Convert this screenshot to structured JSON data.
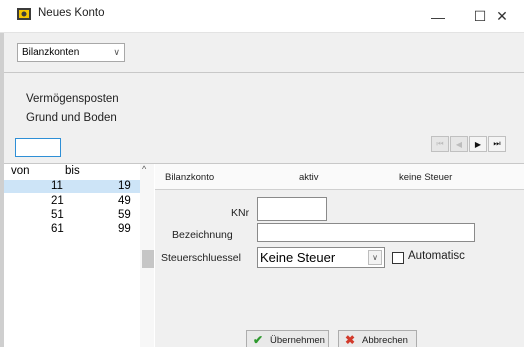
{
  "window": {
    "title": "Neues Konto",
    "minimize": "—",
    "maximize": "☐",
    "close": "✕"
  },
  "toolbar": {
    "account_type_selected": "Bilanzkonten",
    "dropdown_arrow": "∨"
  },
  "info": {
    "category": "Vermögensposten",
    "subcategory": "Grund und Boden"
  },
  "navigation": {
    "first": "⏮",
    "prev": "◀",
    "next": "▶",
    "last": "⏭"
  },
  "range_list": {
    "header_von": "von",
    "header_bis": "bis",
    "scroll_up": "^",
    "rows": [
      {
        "von": "11",
        "bis": "19"
      },
      {
        "von": "21",
        "bis": "49"
      },
      {
        "von": "51",
        "bis": "59"
      },
      {
        "von": "61",
        "bis": "99"
      }
    ]
  },
  "detail_header": {
    "account_type": "Bilanzkonto",
    "status": "aktiv",
    "tax": "keine Steuer"
  },
  "form": {
    "knr_label": "KNr",
    "knr_value": "",
    "bezeichnung_label": "Bezeichnung",
    "bezeichnung_value": "",
    "steuerschluessel_label": "Steuerschluessel",
    "steuerschluessel_value": "Keine Steuer",
    "combo_arrow": "∨",
    "automatic_label": "Automatisc",
    "automatic_checked": false
  },
  "buttons": {
    "apply": "Übernehmen",
    "cancel": "Abbrechen"
  },
  "colors": {
    "selection": "#cde4f7",
    "focus_border": "#2e8fd6",
    "panel_bg": "#f0f0f0",
    "ok_check": "#2f9a2f",
    "cancel_x": "#d23a2b"
  }
}
